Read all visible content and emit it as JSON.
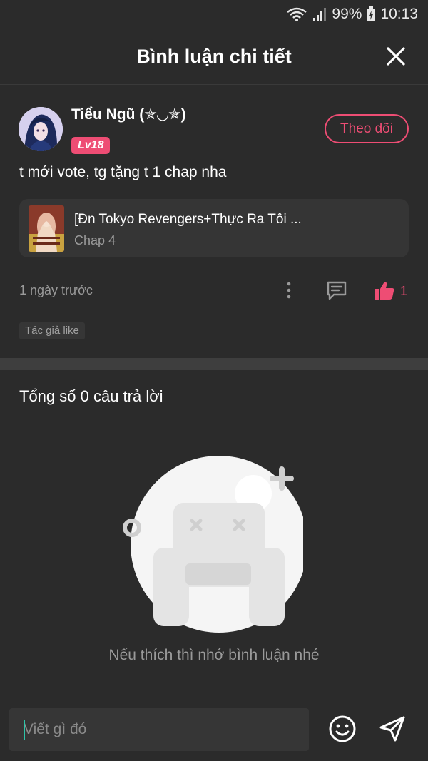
{
  "status_bar": {
    "battery": "99%",
    "time": "10:13",
    "icons": [
      "wifi-icon",
      "signal-icon",
      "battery-icon"
    ]
  },
  "header": {
    "title": "Bình luận chi tiết",
    "close_icon": "close-icon"
  },
  "comment": {
    "username": "Tiểu Ngũ (✯◡✯)",
    "level": "Lv18",
    "follow_label": "Theo dõi",
    "text": "t mới vote, tg tặng t 1 chap nha",
    "book": {
      "title": "[Đn Tokyo Revengers+Thực Ra Tôi ...",
      "chapter": "Chap 4"
    },
    "time": "1 ngày trước",
    "like_count": "1",
    "author_like_tag": "Tác giả like"
  },
  "replies": {
    "count_text": "Tổng số 0 câu trả lời",
    "empty_text": "Nếu thích thì nhớ bình luận nhé"
  },
  "input": {
    "placeholder": "Viết gì đó"
  },
  "colors": {
    "background": "#2b2b2b",
    "accent": "#ee4d74",
    "muted_text": "#9a9a9a",
    "card": "#353535"
  }
}
